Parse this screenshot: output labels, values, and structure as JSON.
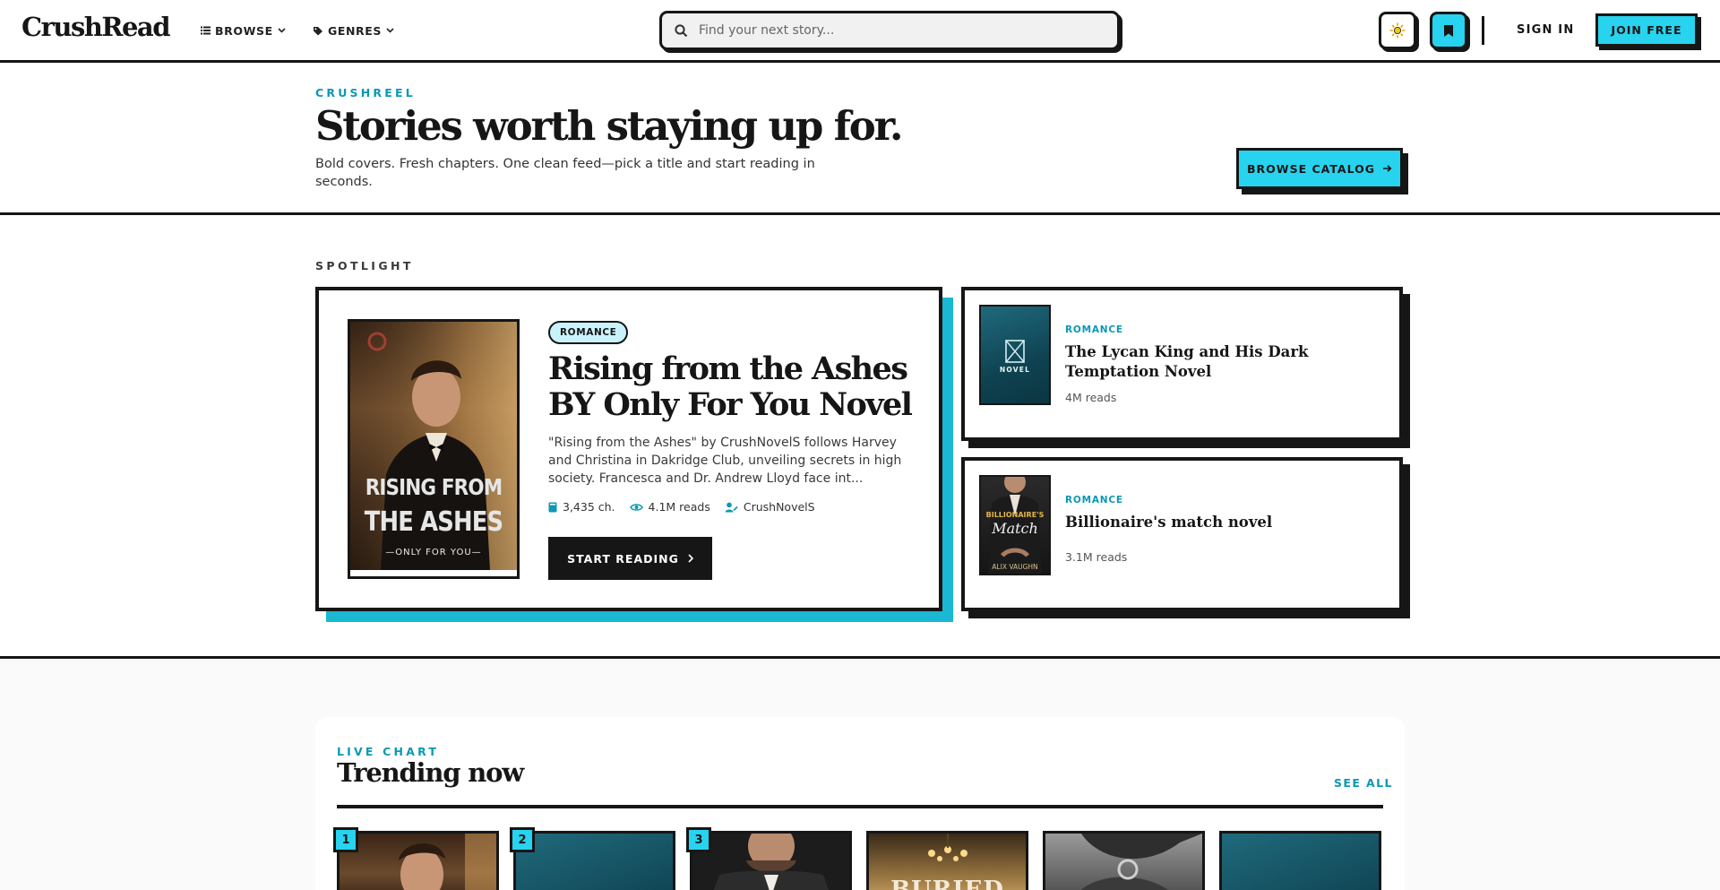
{
  "header": {
    "logo": "CrushRead",
    "nav": [
      {
        "label": "BROWSE",
        "icon": "list-icon"
      },
      {
        "label": "GENRES",
        "icon": "tag-icon"
      }
    ],
    "search_placeholder": "Find your next story...",
    "sign_in": "SIGN IN",
    "join": "JOIN FREE"
  },
  "hero": {
    "eyebrow": "CRUSHREEL",
    "title": "Stories worth staying up for.",
    "subtitle": "Bold covers. Fresh chapters. One clean feed—pick a title and start reading in seconds.",
    "cta": "BROWSE CATALOG"
  },
  "spotlight": {
    "label": "SPOTLIGHT",
    "featured": {
      "genre": "ROMANCE",
      "title": "Rising from the Ashes BY Only For You Novel",
      "description": "\"Rising from the Ashes\" by CrushNovelS follows Harvey and Christina in Dakridge Club, unveiling secrets in high society. Francesca and Dr. Andrew Lloyd face int...",
      "chapters": "3,435 ch.",
      "reads": "4.1M reads",
      "author": "CrushNovelS",
      "cta": "START READING",
      "cover_title_1": "RISING FROM",
      "cover_title_2": "THE ASHES",
      "cover_byline": "—ONLY FOR YOU—"
    },
    "side": [
      {
        "genre": "ROMANCE",
        "title": "The Lycan King and His Dark Temptation Novel",
        "reads": "4M reads",
        "cover_label": "NOVEL"
      },
      {
        "genre": "ROMANCE",
        "title": "Billionaire's match novel",
        "reads": "3.1M reads",
        "cover_title_1": "BILLIONAIRE'S",
        "cover_title_2": "Match",
        "cover_author": "ALIX VAUGHN"
      }
    ]
  },
  "trending": {
    "eyebrow": "LIVE CHART",
    "title": "Trending now",
    "see_all": "SEE ALL",
    "ranks": [
      "1",
      "2",
      "3"
    ],
    "card4_text": "BURIED"
  },
  "colors": {
    "accent": "#27d3ee",
    "accent_dark": "#0b98b4",
    "ink": "#161616"
  }
}
